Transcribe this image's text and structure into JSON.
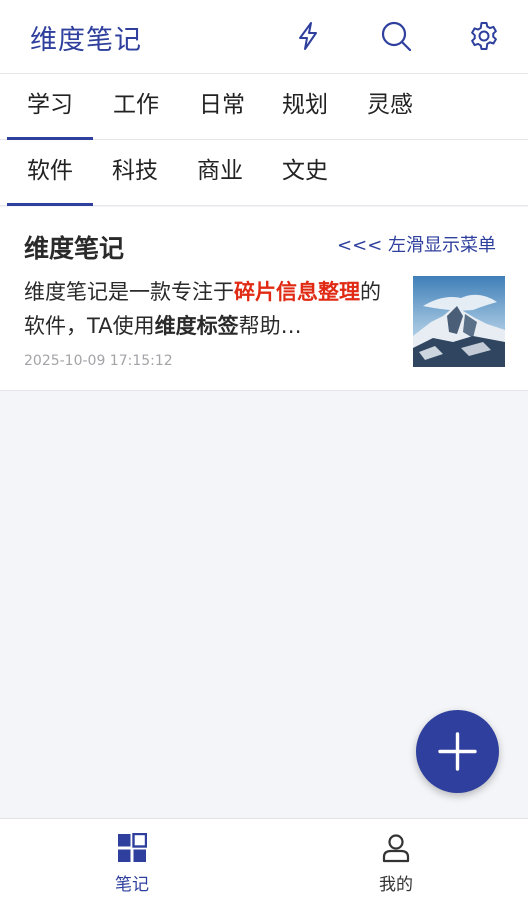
{
  "header": {
    "title": "维度笔记",
    "icons": [
      "flash-icon",
      "search-icon",
      "settings-icon"
    ]
  },
  "categories": {
    "primary": [
      "学习",
      "工作",
      "日常",
      "规划",
      "灵感"
    ],
    "primary_active": "学习",
    "secondary": [
      "软件",
      "科技",
      "商业",
      "文史"
    ],
    "secondary_active": "软件"
  },
  "note": {
    "title": "维度笔记",
    "swipe_hint": "<<< 左滑显示菜单",
    "body": {
      "part1": "维度笔记是一款专注于",
      "highlight1": "碎片信息整理",
      "part2": "的软件，TA使用",
      "highlight2": "维度标签",
      "part3": "帮助…"
    },
    "timestamp": "2025-10-09 17:15:12",
    "thumbnail": "mountain-thumbnail"
  },
  "fab": {
    "icon": "plus-icon"
  },
  "bottom_nav": {
    "items": [
      {
        "label": "笔记",
        "icon": "grid-icon",
        "active": true
      },
      {
        "label": "我的",
        "icon": "user-icon",
        "active": false
      }
    ]
  },
  "colors": {
    "brand": "#2e3f9d",
    "highlight": "#e02a13",
    "background": "#f4f5f8"
  }
}
